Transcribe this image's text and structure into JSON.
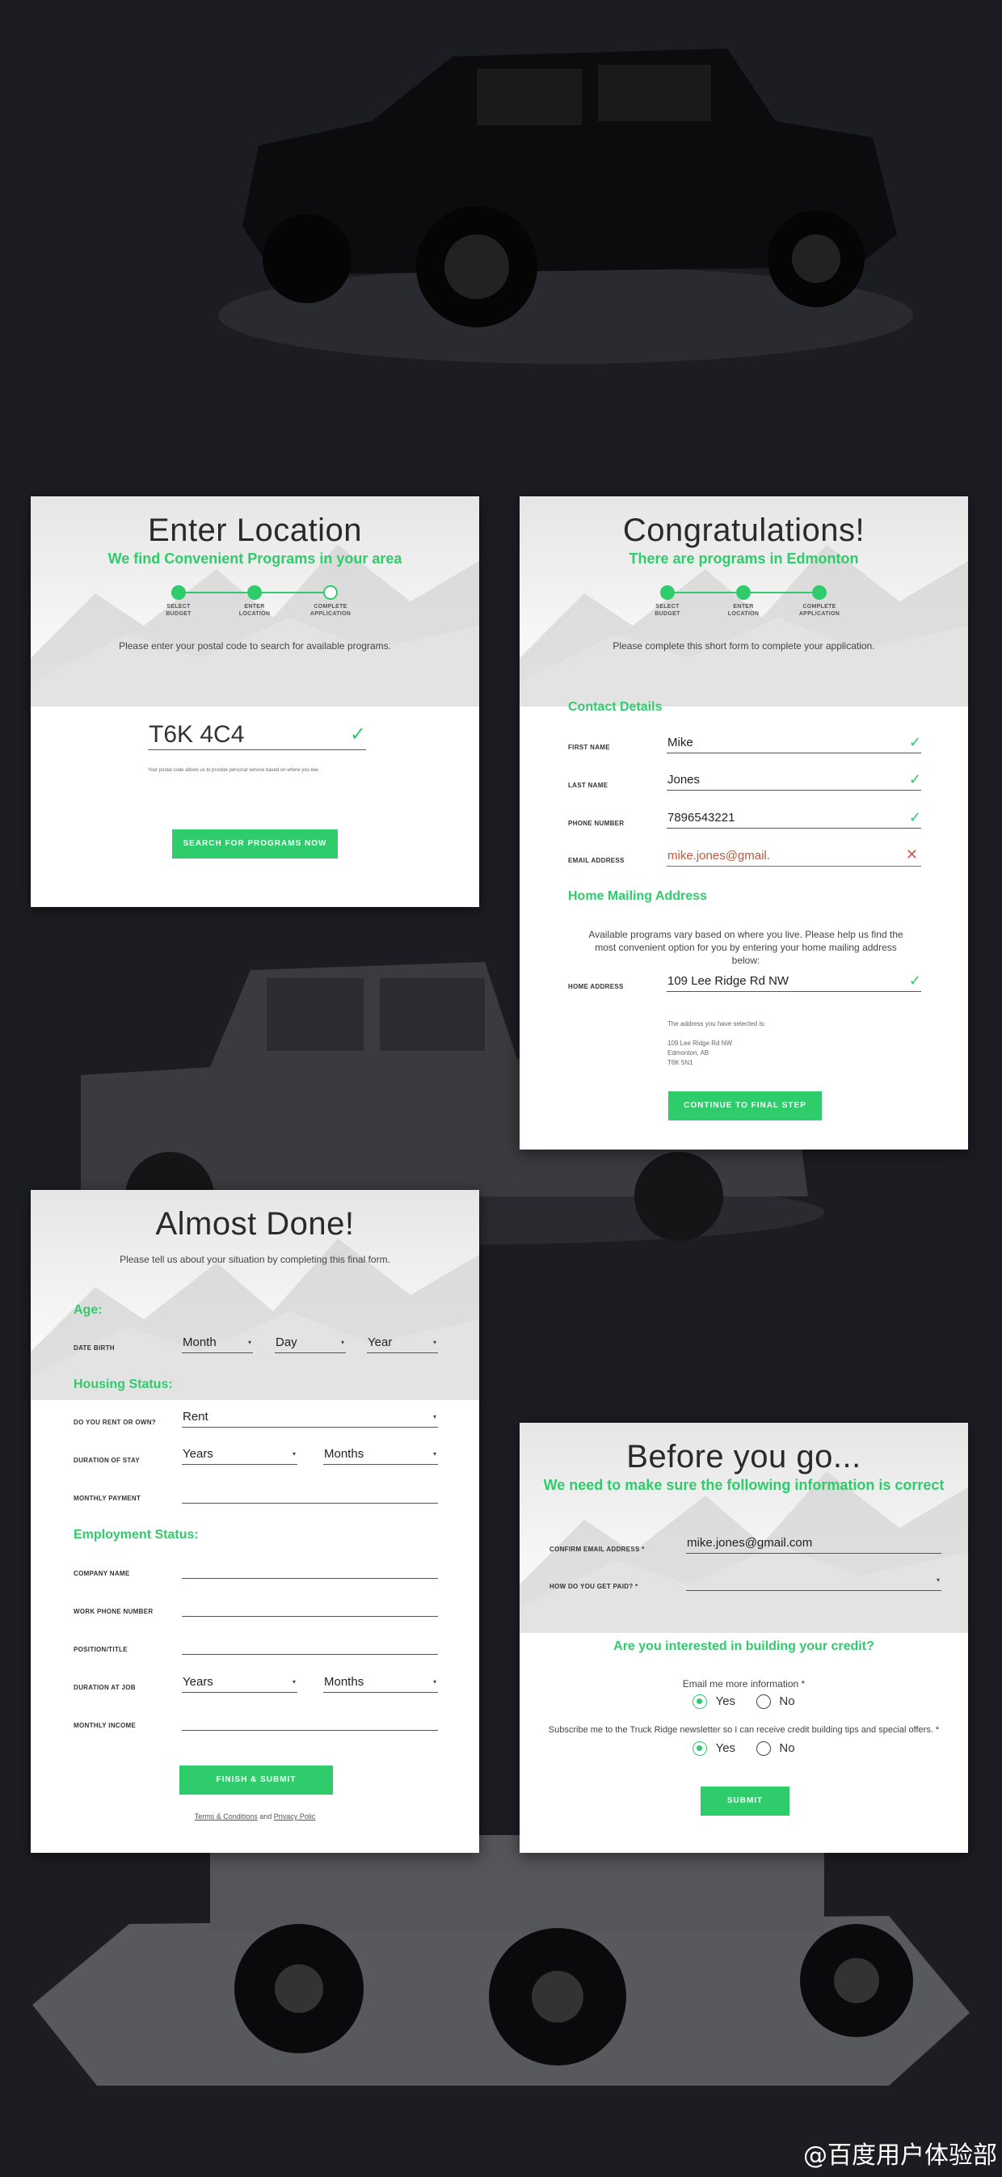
{
  "card1": {
    "title": "Enter Location",
    "subtitle": "We find Convenient Programs in your area",
    "steps": [
      "SELECT\nBUDGET",
      "ENTER\nLOCATION",
      "COMPLETE\nAPPLICATION"
    ],
    "instruction": "Please enter your postal code to search for available programs.",
    "postal_value": "T6K 4C4",
    "postal_note": "Your postal code allows us to provide personal service based on where you live.",
    "button": "SEARCH FOR PROGRAMS NOW"
  },
  "card2": {
    "title": "Congratulations!",
    "subtitle": "There are programs in Edmonton",
    "steps": [
      "SELECT\nBUDGET",
      "ENTER\nLOCATION",
      "COMPLETE\nAPPLICATION"
    ],
    "instruction": "Please complete this short form to complete your application.",
    "contact_heading": "Contact Details",
    "first_name_label": "FIRST NAME",
    "first_name_value": "Mike",
    "last_name_label": "LAST NAME",
    "last_name_value": "Jones",
    "phone_label": "PHONE NUMBER",
    "phone_value": "7896543221",
    "email_label": "EMAIL ADDRESS",
    "email_value": "mike.jones@gmail.",
    "mailing_heading": "Home Mailing Address",
    "mailing_text": "Available programs vary based on where you live. Please help us find the most convenient option for you by entering your home mailing address below:",
    "home_label": "HOME ADDRESS",
    "home_value": "109 Lee Ridge Rd NW",
    "selected_note": "The address you have selected is:",
    "addr_line1": "109 Lee Ridge Rd NW",
    "addr_line2": "Edmonton, AB",
    "addr_line3": "T6K 5N1",
    "button": "CONTINUE TO FINAL STEP"
  },
  "card3": {
    "title": "Almost Done!",
    "instruction": "Please tell us about your situation by completing this final form.",
    "age_heading": "Age:",
    "dob_label": "DATE BIRTH",
    "month": "Month",
    "day": "Day",
    "year": "Year",
    "housing_heading": "Housing Status:",
    "rent_label": "DO YOU RENT OR OWN?",
    "rent_value": "Rent",
    "stay_label": "DURATION OF STAY",
    "years": "Years",
    "months": "Months",
    "monthly_payment_label": "MONTHLY PAYMENT",
    "employment_heading": "Employment Status:",
    "company_label": "COMPANY NAME",
    "work_phone_label": "WORK PHONE NUMBER",
    "position_label": "POSITION/TITLE",
    "job_duration_label": "DURATION AT JOB",
    "monthly_income_label": "MONTHLY INCOME",
    "button": "FINISH & SUBMIT",
    "terms": "Terms & Conditions",
    "and": "and",
    "privacy": "Privacy Polic"
  },
  "card4": {
    "title": "Before you go...",
    "subtitle": "We need to make sure the following information is correct",
    "confirm_email_label": "CONFIRM EMAIL ADDRESS *",
    "confirm_email_value": "mike.jones@gmail.com",
    "paid_label": "HOW DO YOU GET PAID? *",
    "credit_heading": "Are you interested in building your credit?",
    "email_info": "Email me more information *",
    "yes": "Yes",
    "no": "No",
    "newsletter": "Subscribe me to the Truck Ridge newsletter so I can receive credit building tips and special offers. *",
    "button": "SUBMIT"
  },
  "watermark": "@百度用户体验部",
  "colors": {
    "accent": "#2ecc6a",
    "background": "#1c1d22",
    "error": "#d9534f"
  }
}
